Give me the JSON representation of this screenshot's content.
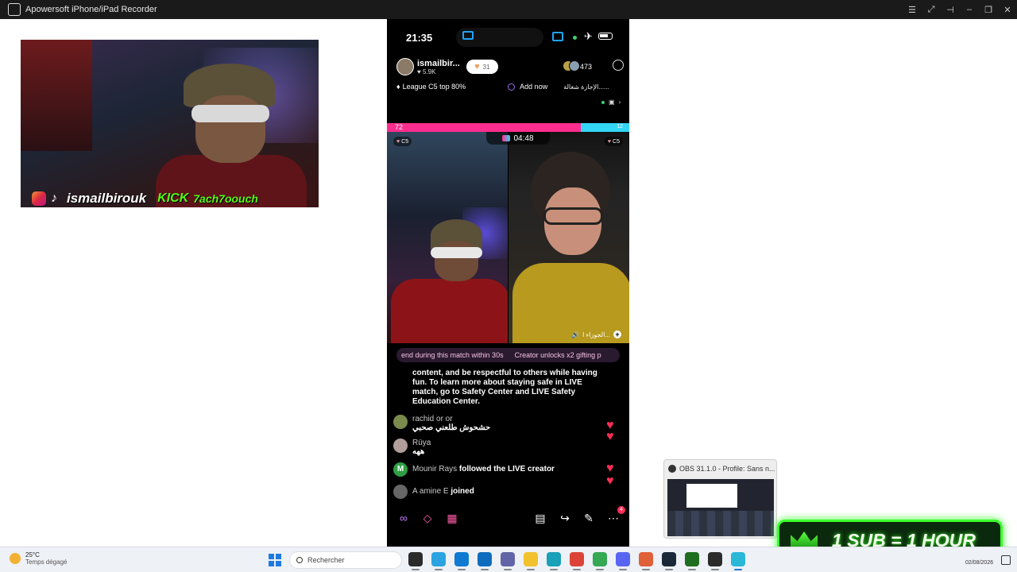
{
  "window": {
    "title": "Apowersoft iPhone/iPad Recorder",
    "controls": [
      "list-icon",
      "expand-icon",
      "pin-icon",
      "minimize-icon",
      "restore-icon",
      "close-icon"
    ]
  },
  "webcam_overlay": {
    "handle": "ismailbirouk",
    "kick_label": "KICK",
    "kick_name": "7ach7oouch"
  },
  "phone": {
    "status": {
      "time": "21:35"
    },
    "host": {
      "name": "ismailbir...",
      "likes": "5.9K",
      "favorites": "31"
    },
    "viewers": "473",
    "league": {
      "text": "League C5 top 80%",
      "add_label": "Add now",
      "arabic": "الإجازة شغالة......"
    },
    "score": {
      "left": "72",
      "right": "12"
    },
    "battle": {
      "timer": "04:48",
      "tag_left": "C5",
      "tag_right": "C5",
      "partner": "الجوزاء ا..."
    },
    "ticker": [
      "end during this match within 30s",
      "Creator unlocks x2 gifting p"
    ],
    "chat": {
      "notice": "content, and be respectful to others while having fun. To learn more about staying safe in LIVE match, go to Safety Center and LIVE Safety Education Center.",
      "messages": [
        {
          "user": "rachid or or",
          "text": "حشحوش طلعني صحبي"
        },
        {
          "user": "Rüya",
          "text": "ههه"
        },
        {
          "user": "Mounir Rays",
          "action": "followed the LIVE creator",
          "avatar_letter": "M"
        },
        {
          "user": "A amine E",
          "action": "joined"
        }
      ]
    },
    "bottombar": {
      "badge": "4"
    }
  },
  "obs_popup": {
    "title": "OBS 31.1.0 - Profile: Sans n..."
  },
  "promo": {
    "text": "1 SUB = 1 HOUR"
  },
  "taskbar": {
    "weather_temp": "25°C",
    "weather_desc": "Temps dégagé",
    "search_placeholder": "Rechercher",
    "apps": [
      {
        "name": "file-explorer-icon",
        "color": "#2b2b2b"
      },
      {
        "name": "telegram-icon",
        "color": "#2aa3e0"
      },
      {
        "name": "calculator-icon",
        "color": "#0f7ad1"
      },
      {
        "name": "outlook-icon",
        "color": "#0f6cbd"
      },
      {
        "name": "teams-icon",
        "color": "#6264a7"
      },
      {
        "name": "folder-icon",
        "color": "#f2c12e"
      },
      {
        "name": "edge-icon",
        "color": "#1aa0b8"
      },
      {
        "name": "chrome-icon",
        "color": "#db4437"
      },
      {
        "name": "chrome-profile-icon",
        "color": "#34a853"
      },
      {
        "name": "discord-icon",
        "color": "#5865f2"
      },
      {
        "name": "chrome-alt-icon",
        "color": "#e0603a"
      },
      {
        "name": "steam-icon",
        "color": "#1b2838"
      },
      {
        "name": "streaming-app-icon",
        "color": "#1f6d1f"
      },
      {
        "name": "obs-icon",
        "color": "#2b2b2b"
      },
      {
        "name": "recorder-icon",
        "color": "#2ab7d8"
      }
    ],
    "date": "02/08/2026"
  },
  "colors": {
    "pink": "#ff2d8e",
    "cyan": "#33d6f5",
    "promo_green": "#3cff2e"
  }
}
